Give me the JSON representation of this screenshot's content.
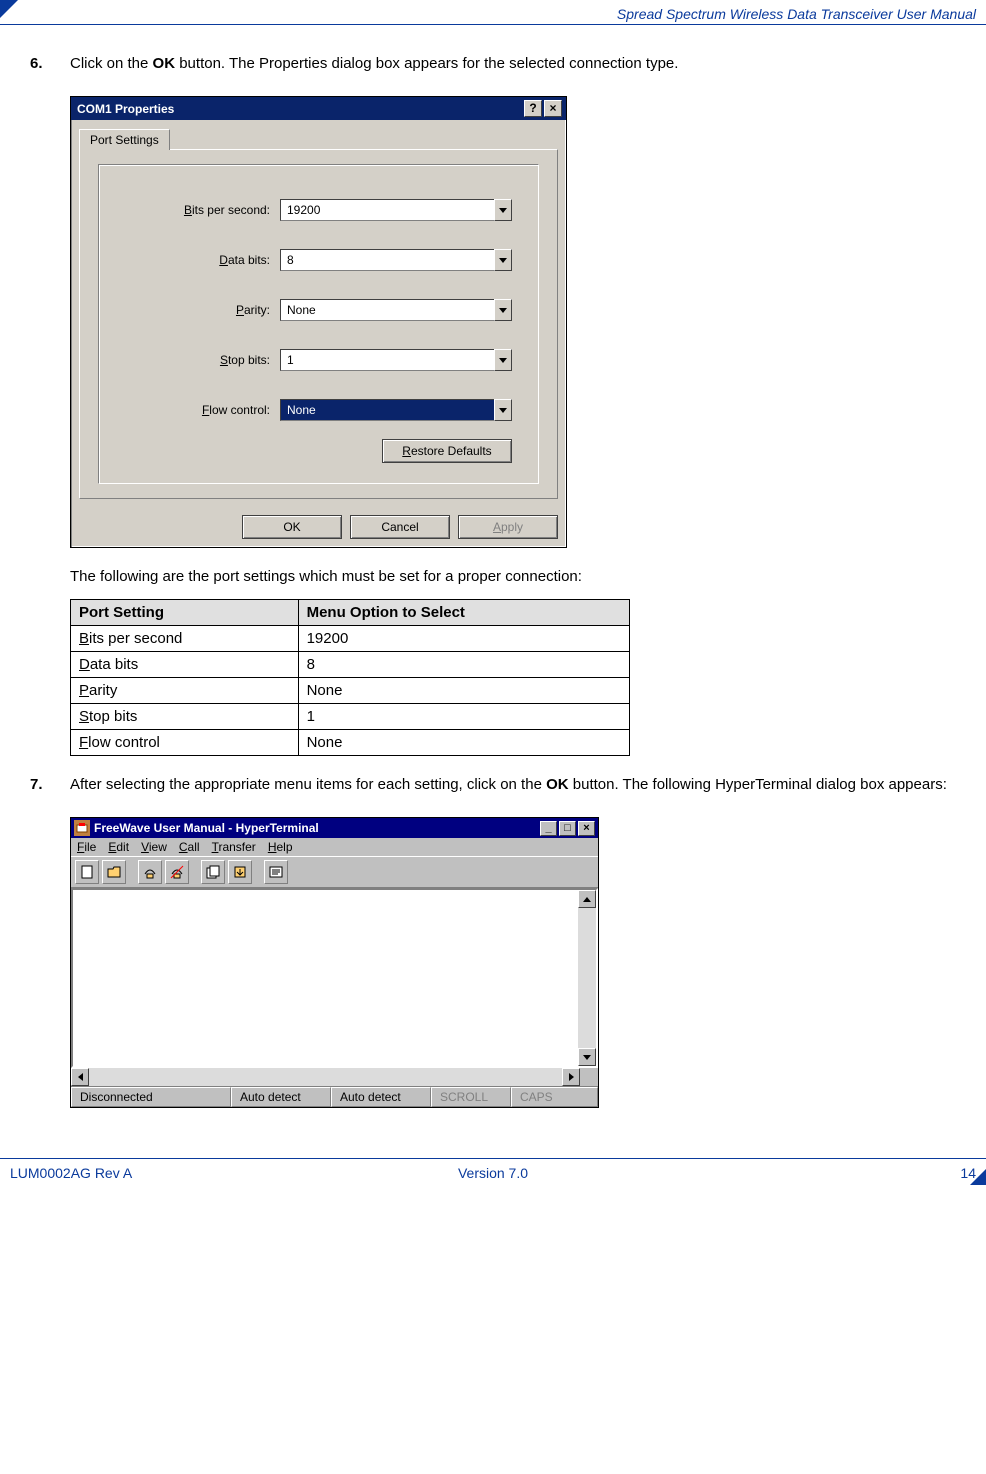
{
  "header": {
    "title": "Spread Spectrum Wireless Data Transceiver User Manual"
  },
  "step6": {
    "num": "6.",
    "text_before": "Click on the ",
    "ok": "OK",
    "text_after": " button. The Properties dialog box appears for the selected connection type."
  },
  "dialog": {
    "title": "COM1 Properties",
    "help": "?",
    "close": "×",
    "tab": "Port Settings",
    "rows": {
      "bps": {
        "label": "Bits per second:",
        "value": "19200"
      },
      "databits": {
        "label": "Data bits:",
        "value": "8"
      },
      "parity": {
        "label": "Parity:",
        "value": "None"
      },
      "stopbits": {
        "label": "Stop bits:",
        "value": "1"
      },
      "flow": {
        "label": "Flow control:",
        "value": "None"
      }
    },
    "restore": "Restore Defaults",
    "ok": "OK",
    "cancel": "Cancel",
    "apply": "Apply"
  },
  "table_intro": "The following are the port settings which must be set for a proper connection:",
  "table": {
    "h1": "Port Setting",
    "h2": "Menu Option to Select",
    "rows": [
      {
        "u": "B",
        "rest": "its per second",
        "val": "19200"
      },
      {
        "u": "D",
        "rest": "ata bits",
        "val": "8"
      },
      {
        "u": "P",
        "rest": "arity",
        "val": "None"
      },
      {
        "u": "S",
        "rest": "top bits",
        "val": "1"
      },
      {
        "u": "F",
        "rest": "low control",
        "val": "None"
      }
    ]
  },
  "step7": {
    "num": "7.",
    "text_before": "After selecting the appropriate menu items for each setting, click on the ",
    "ok": "OK",
    "text_after": " button. The following HyperTerminal dialog box appears:"
  },
  "ht": {
    "title": "FreeWave User Manual - HyperTerminal",
    "menu": {
      "file": {
        "u": "F",
        "rest": "ile"
      },
      "edit": {
        "u": "E",
        "rest": "dit"
      },
      "view": {
        "u": "V",
        "rest": "iew"
      },
      "call": {
        "u": "C",
        "rest": "all"
      },
      "transfer": {
        "u": "T",
        "rest": "ransfer"
      },
      "help": {
        "u": "H",
        "rest": "elp"
      }
    },
    "status": {
      "conn": "Disconnected",
      "auto1": "Auto detect",
      "auto2": "Auto detect",
      "scroll": "SCROLL",
      "caps": "CAPS"
    }
  },
  "footer": {
    "left": "LUM0002AG Rev A",
    "center": "Version 7.0",
    "right": "14"
  }
}
